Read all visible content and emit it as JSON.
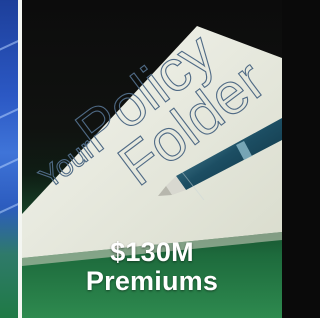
{
  "tile": {
    "folder_text_1": "Your",
    "folder_text_2": "Policy",
    "folder_text_3": "Folder",
    "headline_amount": "$130M",
    "headline_label": "Premiums"
  },
  "colors": {
    "green": "#2e8a4f",
    "dark": "#0c0c0c",
    "left_blue": "#2b58c4"
  },
  "icons": {
    "pen": "pen-icon",
    "folder": "policy-folder-image"
  }
}
